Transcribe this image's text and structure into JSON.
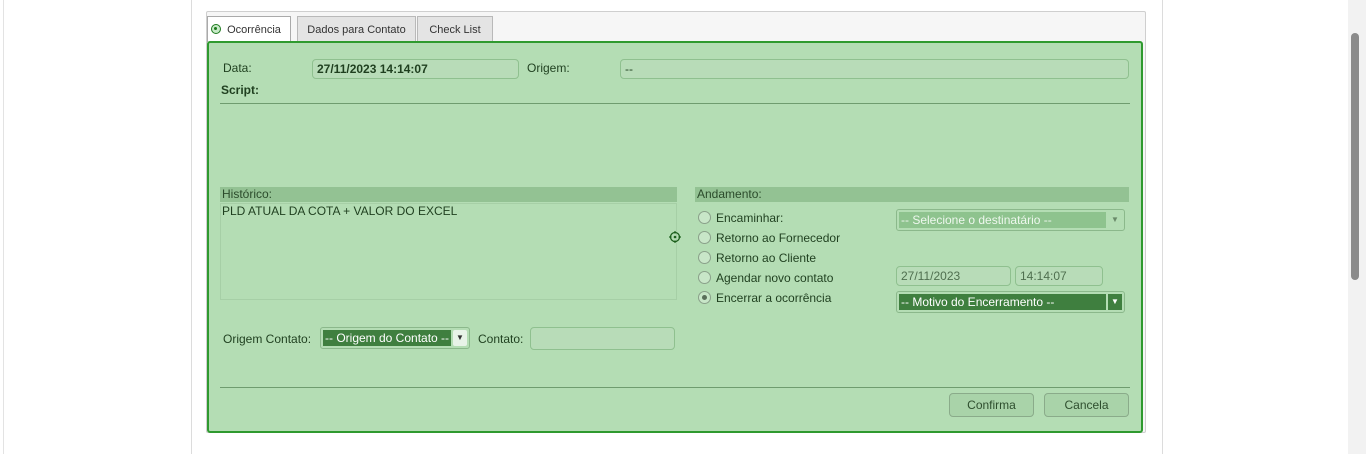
{
  "tabs": [
    {
      "label": "Ocorrência",
      "active": true
    },
    {
      "label": "Dados para Contato",
      "active": false
    },
    {
      "label": "Check List",
      "active": false
    }
  ],
  "form": {
    "data_label": "Data:",
    "data_value": "27/11/2023 14:14:07",
    "origem_label": "Origem:",
    "origem_value": "--",
    "script_label": "Script:"
  },
  "historico": {
    "label": "Histórico:",
    "text": "PLD ATUAL DA COTA + VALOR DO EXCEL"
  },
  "andamento": {
    "label": "Andamento:",
    "options": [
      {
        "label": "Encaminhar:",
        "checked": false
      },
      {
        "label": "Retorno ao Fornecedor",
        "checked": false
      },
      {
        "label": "Retorno ao Cliente",
        "checked": false
      },
      {
        "label": "Agendar novo contato",
        "checked": false
      },
      {
        "label": "Encerrar a ocorrência",
        "checked": true
      }
    ],
    "destinatario_select": "-- Selecione o destinatário --",
    "agendar_date": "27/11/2023",
    "agendar_time": "14:14:07",
    "motivo_select": "-- Motivo do Encerramento --"
  },
  "contact": {
    "origem_contato_label": "Origem Contato:",
    "origem_contato_select": "-- Origem do Contato --",
    "contato_label": "Contato:",
    "contato_value": ""
  },
  "buttons": {
    "confirma": "Confirma",
    "cancela": "Cancela"
  },
  "colors": {
    "panel_bg": "#b4ddb4",
    "panel_border": "#2f9a2f",
    "dropdown_dark": "#3f7f3f"
  }
}
